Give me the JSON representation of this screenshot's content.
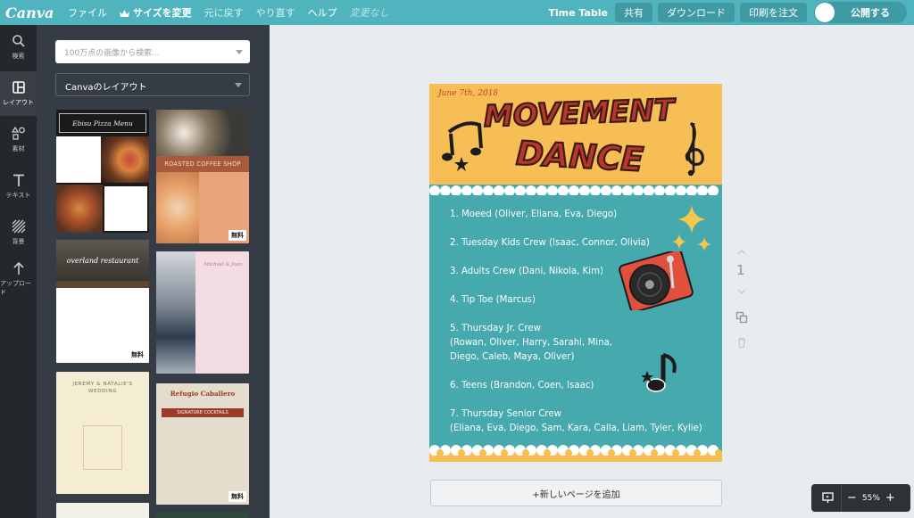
{
  "app": {
    "logo": "Canva"
  },
  "menu": {
    "file": "ファイル",
    "resize": "サイズを変更",
    "undo": "元に戻す",
    "redo": "やり直す",
    "help": "ヘルプ",
    "status": "変更なし"
  },
  "toolbar": {
    "doc_title": "Time Table",
    "share": "共有",
    "download": "ダウンロード",
    "print": "印刷を注文",
    "publish": "公開する"
  },
  "leftnav": [
    {
      "label": "検索",
      "icon": "search-icon"
    },
    {
      "label": "レイアウト",
      "icon": "layout-icon"
    },
    {
      "label": "素材",
      "icon": "elements-icon"
    },
    {
      "label": "テキスト",
      "icon": "text-icon"
    },
    {
      "label": "背景",
      "icon": "background-icon"
    },
    {
      "label": "アップロード",
      "icon": "upload-icon"
    }
  ],
  "panel": {
    "search_placeholder": "100万点の画像から検索...",
    "layout_select": "Canvaのレイアウト",
    "free_badge": "無料",
    "templates": [
      {
        "title": "Ebisu Pizza Menu"
      },
      {
        "title": "ROASTED COFFEE SHOP"
      },
      {
        "title": "overland restaurant"
      },
      {
        "title": "Michael & Joan"
      },
      {
        "title": "JEREMY & NATALIE'S WEDDING"
      },
      {
        "title": "Refugio Caballero",
        "subtitle": "SIGNATURE COCKTAILS"
      }
    ]
  },
  "poster": {
    "date": "June 7th, 2018",
    "title_line1": "MOVEMENT",
    "title_line2": "DANCE",
    "lines": [
      "1. Moeed  (Oliver, Eliana, Eva, Diego)",
      "2. Tuesday  Kids Crew  (Isaac, Connor, Olivia)",
      "3. Adults Crew (Dani, Nikola, Kim)",
      "4. Tip Toe (Marcus)",
      "5. Thursday Jr. Crew",
      "(Rowan, Oliver, Harry, Sarahi, Mina,",
      "Diego, Caleb, Maya, Oliver)",
      "6. Teens (Brandon, Coen, Isaac)",
      "7. Thursday Senior Crew",
      "(Eliana, Eva, Diego, Sam, Kara, Calla, Liam, Tyler, Kylie)"
    ],
    "colors": {
      "yellow": "#f7be55",
      "teal": "#45a9ae",
      "red": "#c0432f"
    }
  },
  "canvas": {
    "page_number": "1",
    "add_page": "+新しいページを追加",
    "zoom": "55%"
  }
}
